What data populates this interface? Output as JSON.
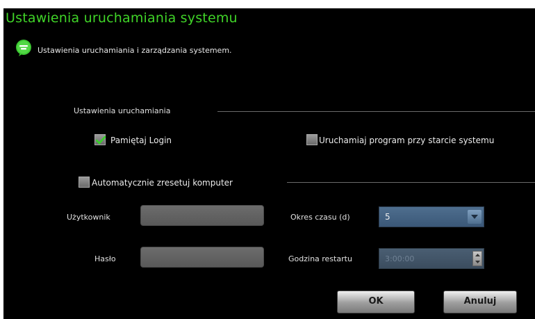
{
  "window": {
    "title": "Ustawienia uruchamiania systemu",
    "subtitle": "Ustawienia uruchamiania i zarządzania systemem.",
    "icon": "chat-bubble-icon",
    "accent_color": "#40d428"
  },
  "startup": {
    "section_label": "Ustawienia uruchamiania",
    "remember_login": {
      "label": "Pamiętaj Login",
      "checked": true
    },
    "run_at_startup": {
      "label": "Uruchamiaj program przy starcie systemu",
      "checked": false
    }
  },
  "auto_restart": {
    "label": "Automatycznie zresetuj komputer",
    "checked": false,
    "user_label": "Użytkownik",
    "user_value": "",
    "password_label": "Hasło",
    "password_value": "",
    "period_label": "Okres czasu (d)",
    "period_value": "5",
    "restart_time_label": "Godzina restartu",
    "restart_time_value": "3:00:00"
  },
  "buttons": {
    "ok": "OK",
    "cancel": "Anuluj"
  }
}
